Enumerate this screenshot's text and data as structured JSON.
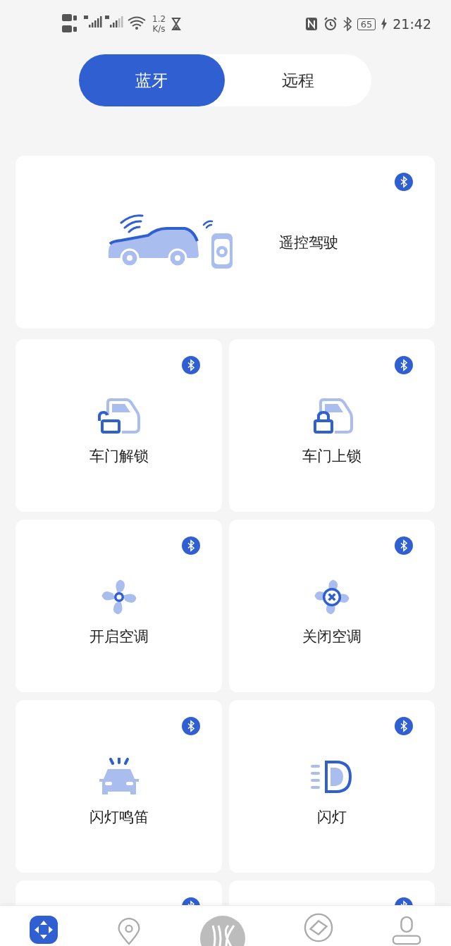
{
  "status_bar": {
    "speed_value": "1.2",
    "speed_unit": "K/s",
    "battery": "65",
    "time": "21:42"
  },
  "tabs": [
    {
      "label": "蓝牙",
      "selected": true
    },
    {
      "label": "远程",
      "selected": false
    }
  ],
  "feature_card": {
    "label": "遥控驾驶",
    "bluetooth": true
  },
  "tiles": [
    {
      "label": "车门解锁",
      "bluetooth": true
    },
    {
      "label": "车门上锁",
      "bluetooth": true
    },
    {
      "label": "开启空调",
      "bluetooth": true
    },
    {
      "label": "关闭空调",
      "bluetooth": true
    },
    {
      "label": "闪灯鸣笛",
      "bluetooth": true
    },
    {
      "label": "闪灯",
      "bluetooth": true
    },
    {
      "bluetooth": true
    },
    {
      "bluetooth": true
    }
  ],
  "bottom_nav": {
    "items": [
      {
        "selected": true
      },
      {
        "selected": false
      },
      {
        "selected": false
      },
      {
        "selected": false
      },
      {
        "selected": false
      }
    ]
  }
}
